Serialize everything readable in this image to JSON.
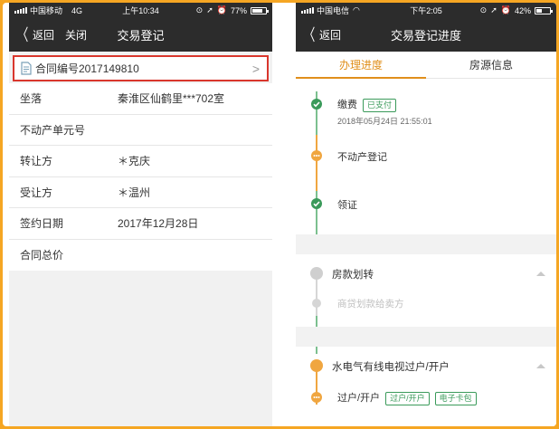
{
  "left": {
    "status": {
      "carrier": "中国移动",
      "network": "4G",
      "time": "上午10:34",
      "battery": "77%",
      "battery_level": 0.77
    },
    "nav": {
      "back": "返回",
      "close": "关闭",
      "title": "交易登记"
    },
    "contract": {
      "label": "合同编号2017149810"
    },
    "rows": [
      {
        "label": "坐落",
        "value": "秦淮区仙鹤里***702室"
      },
      {
        "label": "不动产单元号",
        "value": ""
      },
      {
        "label": "转让方",
        "value": "＊克庆"
      },
      {
        "label": "受让方",
        "value": "＊温州"
      },
      {
        "label": "签约日期",
        "value": "2017年12月28日"
      },
      {
        "label": "合同总价",
        "value": ""
      }
    ]
  },
  "right": {
    "status": {
      "carrier": "中国电信",
      "time": "下午2:05",
      "battery": "42%",
      "battery_level": 0.42
    },
    "nav": {
      "back": "返回",
      "title": "交易登记进度"
    },
    "tabs": [
      {
        "label": "办理进度"
      },
      {
        "label": "房源信息"
      }
    ],
    "steps": {
      "pay": {
        "label": "缴费",
        "tag": "已支付",
        "time": "2018年05月24日 21:55:01"
      },
      "register": {
        "label": "不动产登记"
      },
      "cert": {
        "label": "领证"
      }
    },
    "funds": {
      "title": "房款划转",
      "sub": "商贷划款给卖方"
    },
    "utility": {
      "title": "水电气有线电视过户/开户",
      "sub": "过户/开户",
      "tags": [
        "过户/开户",
        "电子卡包"
      ]
    }
  },
  "colors": {
    "frame": "#f5a623",
    "accent": "#e08f1b",
    "green": "#3a9a5a",
    "red_box": "#d9362d",
    "bar": "#2c2c2c"
  }
}
